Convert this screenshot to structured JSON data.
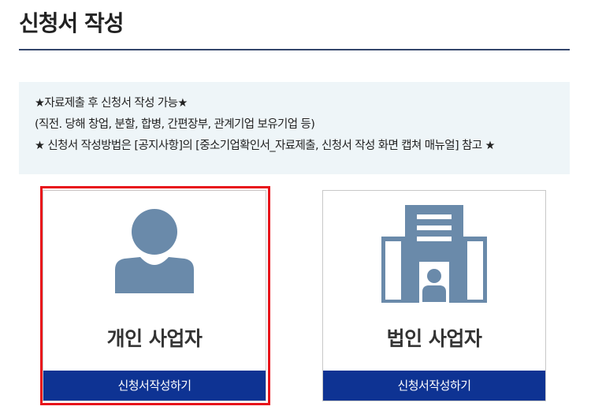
{
  "page": {
    "title": "신청서 작성"
  },
  "notice": {
    "line1": "★자료제출 후 신청서 작성 가능★",
    "line2": "(직전. 당해 창업, 분할, 합병, 간편장부, 관계기업 보유기업 등)",
    "line3": "★ 신청서 작성방법은 [공지사항]의 [중소기업확인서_자료제출, 신청서 작성 화면 캡쳐 매뉴얼] 참고 ★"
  },
  "cards": [
    {
      "label": "개인 사업자",
      "button_label": "신청서작성하기",
      "icon": "person-icon",
      "selected": true
    },
    {
      "label": "법인 사업자",
      "button_label": "신청서작성하기",
      "icon": "building-icon",
      "selected": false
    }
  ],
  "colors": {
    "accent_button": "#0e3393",
    "icon": "#6a8aaa",
    "selection_border": "#e8141b",
    "notice_background": "#eef5f8",
    "title_rule": "#33456b"
  }
}
